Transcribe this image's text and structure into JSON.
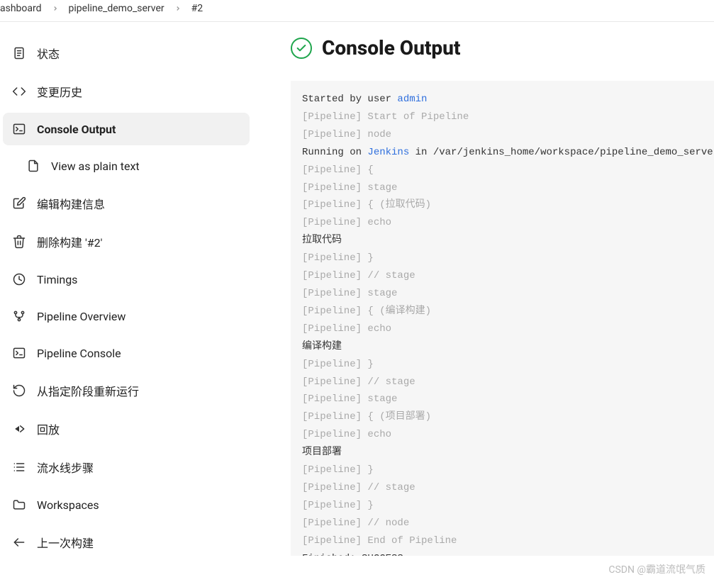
{
  "breadcrumb": {
    "items": [
      "ashboard",
      "pipeline_demo_server",
      "#2"
    ]
  },
  "sidebar": {
    "items": [
      {
        "label": "状态",
        "icon": "document-icon"
      },
      {
        "label": "变更历史",
        "icon": "code-icon"
      },
      {
        "label": "Console Output",
        "icon": "terminal-icon",
        "active": true
      },
      {
        "label": "View as plain text",
        "icon": "file-icon",
        "sub": true
      },
      {
        "label": "编辑构建信息",
        "icon": "edit-icon"
      },
      {
        "label": "删除构建 '#2'",
        "icon": "trash-icon"
      },
      {
        "label": "Timings",
        "icon": "clock-icon"
      },
      {
        "label": "Pipeline Overview",
        "icon": "branch-icon"
      },
      {
        "label": "Pipeline Console",
        "icon": "terminal-icon"
      },
      {
        "label": "从指定阶段重新运行",
        "icon": "restart-icon"
      },
      {
        "label": "回放",
        "icon": "replay-icon"
      },
      {
        "label": "流水线步骤",
        "icon": "steps-icon"
      },
      {
        "label": "Workspaces",
        "icon": "folder-icon"
      },
      {
        "label": "上一次构建",
        "icon": "arrow-left-icon"
      }
    ]
  },
  "header": {
    "title": "Console Output"
  },
  "console": {
    "lines": [
      [
        {
          "t": "Started by user "
        },
        {
          "t": "admin",
          "link": true
        }
      ],
      [
        {
          "t": "[Pipeline] Start of Pipeline",
          "gray": true
        }
      ],
      [
        {
          "t": "[Pipeline] node",
          "gray": true
        }
      ],
      [
        {
          "t": "Running on "
        },
        {
          "t": "Jenkins",
          "link": true
        },
        {
          "t": " in /var/jenkins_home/workspace/pipeline_demo_server"
        }
      ],
      [
        {
          "t": "[Pipeline] {",
          "gray": true
        }
      ],
      [
        {
          "t": "[Pipeline] stage",
          "gray": true
        }
      ],
      [
        {
          "t": "[Pipeline] { (拉取代码)",
          "gray": true
        }
      ],
      [
        {
          "t": "[Pipeline] echo",
          "gray": true
        }
      ],
      [
        {
          "t": "拉取代码"
        }
      ],
      [
        {
          "t": "[Pipeline] }",
          "gray": true
        }
      ],
      [
        {
          "t": "[Pipeline] // stage",
          "gray": true
        }
      ],
      [
        {
          "t": "[Pipeline] stage",
          "gray": true
        }
      ],
      [
        {
          "t": "[Pipeline] { (编译构建)",
          "gray": true
        }
      ],
      [
        {
          "t": "[Pipeline] echo",
          "gray": true
        }
      ],
      [
        {
          "t": "编译构建"
        }
      ],
      [
        {
          "t": "[Pipeline] }",
          "gray": true
        }
      ],
      [
        {
          "t": "[Pipeline] // stage",
          "gray": true
        }
      ],
      [
        {
          "t": "[Pipeline] stage",
          "gray": true
        }
      ],
      [
        {
          "t": "[Pipeline] { (项目部署)",
          "gray": true
        }
      ],
      [
        {
          "t": "[Pipeline] echo",
          "gray": true
        }
      ],
      [
        {
          "t": "项目部署"
        }
      ],
      [
        {
          "t": "[Pipeline] }",
          "gray": true
        }
      ],
      [
        {
          "t": "[Pipeline] // stage",
          "gray": true
        }
      ],
      [
        {
          "t": "[Pipeline] }",
          "gray": true
        }
      ],
      [
        {
          "t": "[Pipeline] // node",
          "gray": true
        }
      ],
      [
        {
          "t": "[Pipeline] End of Pipeline",
          "gray": true
        }
      ],
      [
        {
          "t": "Finished: SUCCESS"
        }
      ]
    ]
  },
  "watermark": "CSDN @霸道流氓气质"
}
